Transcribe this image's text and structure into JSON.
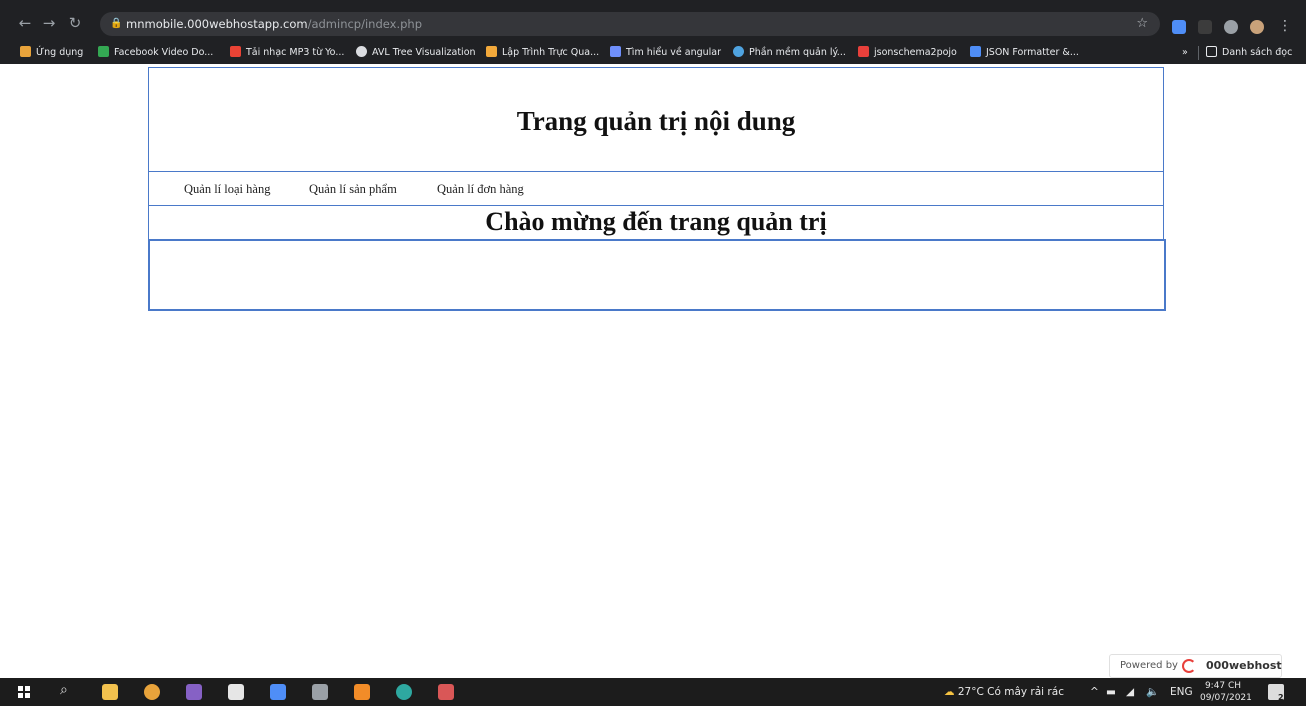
{
  "browser": {
    "url_host": "mnmobile.000webhostapp.com",
    "url_path": "/admincp/index.php",
    "bookmarks": [
      "Ứng dụng",
      "Facebook Video Do...",
      "Tải nhạc MP3 từ Yo...",
      "AVL Tree Visualization",
      "Lập Trình Trực Qua...",
      "Tìm hiểu về angular",
      "Phần mềm quản lý...",
      "jsonschema2pojo",
      "JSON Formatter &..."
    ],
    "more_bookmarks": "»",
    "reading_list": "Danh sách đọc"
  },
  "page": {
    "header_title": "Trang quản trị nội dung",
    "menu": [
      "Quản lí loại hàng",
      "Quản lí sản phẩm",
      "Quản lí đơn hàng"
    ],
    "welcome": "Chào mừng đến trang quản trị"
  },
  "badge": {
    "label": "Powered by",
    "brand": "000webhost"
  },
  "taskbar": {
    "weather": "27°C  Có mây rải rác",
    "language": "ENG",
    "time": "9:47 CH",
    "date": "09/07/2021",
    "notifications": "2"
  },
  "colors": {
    "border": "#4a79c9",
    "chrome": "#202124",
    "taskbar": "#1c1c1c"
  }
}
